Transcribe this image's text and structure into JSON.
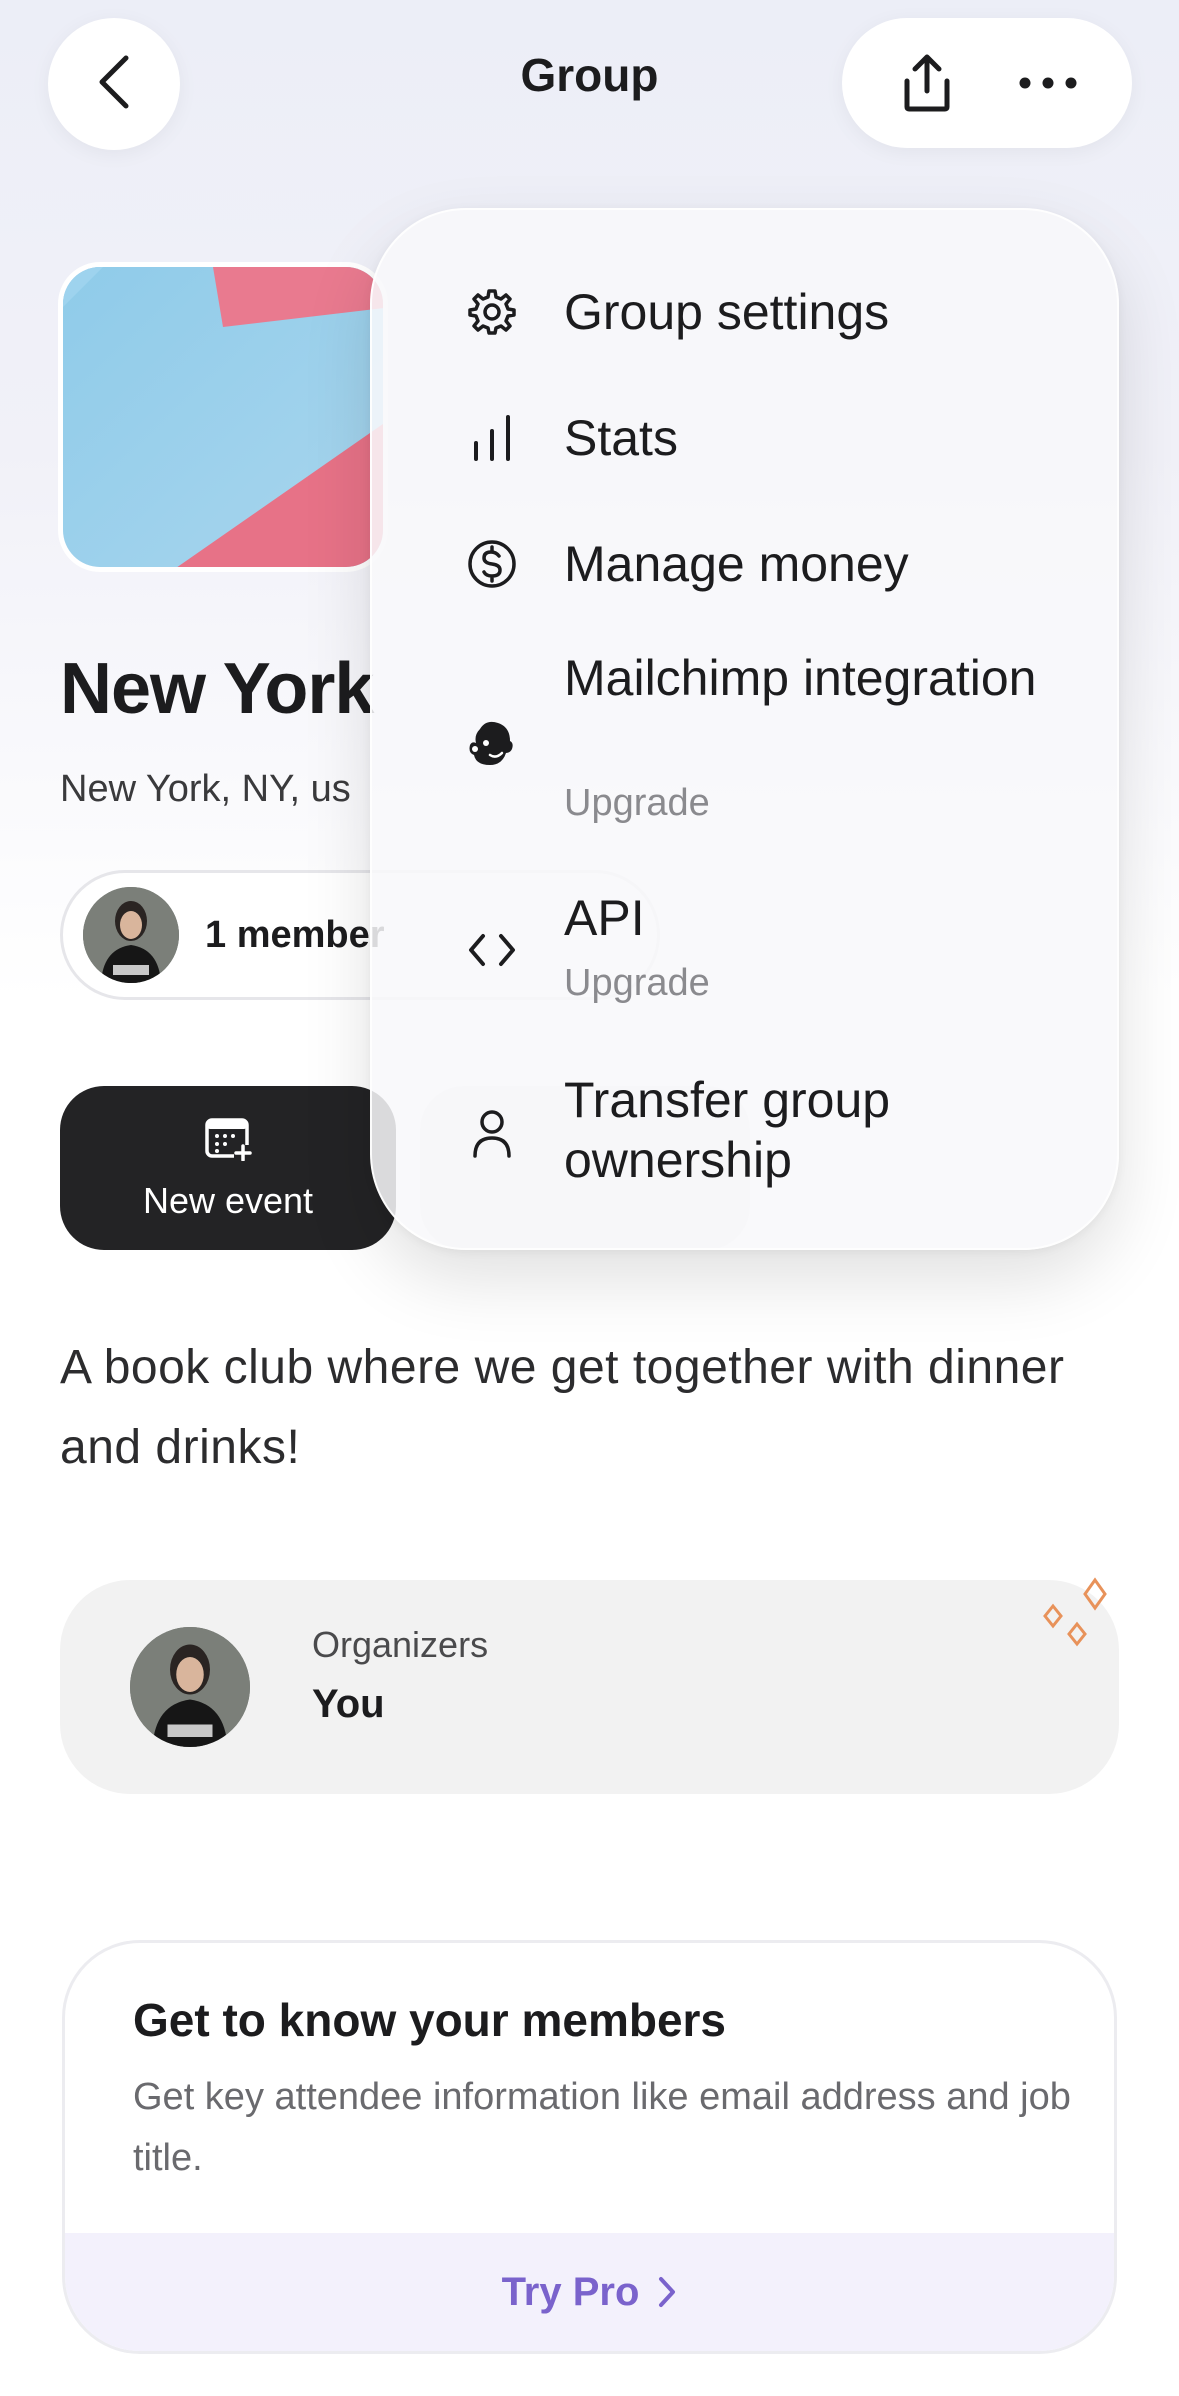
{
  "header": {
    "title": "Group",
    "back_icon": "chevron-left-icon",
    "share_icon": "share-icon",
    "more_icon": "ellipsis-icon"
  },
  "group": {
    "name": "New York",
    "location": "New York, NY, us",
    "members_label": "1 member"
  },
  "actions": {
    "new_event_label": "New event"
  },
  "description": "A book club where we get together with dinner and drinks!",
  "organizers": {
    "heading": "Organizers",
    "name": "You"
  },
  "pro_card": {
    "title": "Get to know your members",
    "body": "Get key attendee information like email address and job title.",
    "cta": "Try Pro"
  },
  "menu": {
    "items": [
      {
        "label": "Group settings",
        "icon": "gear-icon"
      },
      {
        "label": "Stats",
        "icon": "bar-chart-icon"
      },
      {
        "label": "Manage money",
        "icon": "dollar-circle-icon"
      },
      {
        "label": "Mailchimp integration",
        "sub": "Upgrade",
        "icon": "mailchimp-icon"
      },
      {
        "label": "API",
        "sub": "Upgrade",
        "icon": "code-icon"
      },
      {
        "label": "Transfer group ownership",
        "icon": "person-icon"
      }
    ]
  },
  "colors": {
    "accent": "#7a63cc",
    "dark_button": "#232325",
    "sparkle": "#e8925a"
  }
}
